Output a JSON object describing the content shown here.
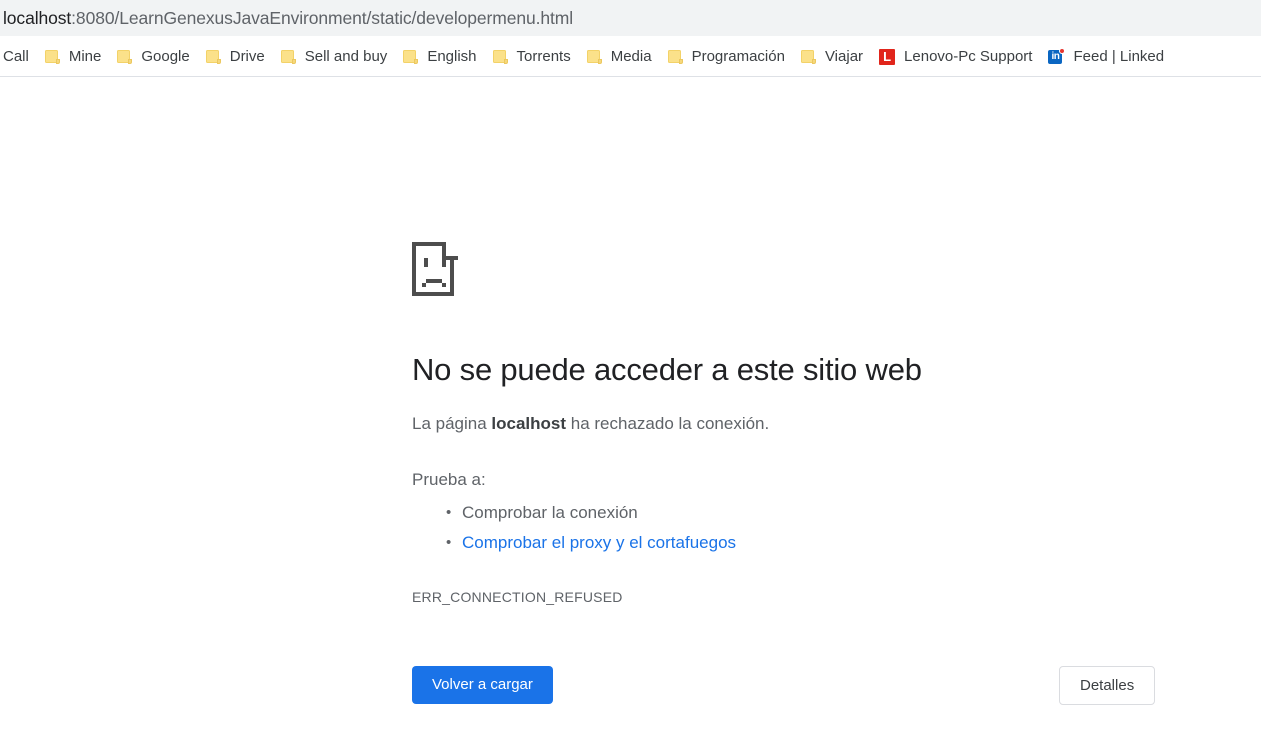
{
  "omnibox": {
    "url_host": "localhost",
    "url_rest": ":8080/LearnGenexusJavaEnvironment/static/developermenu.html"
  },
  "bookmarks": [
    {
      "label": "Call",
      "icon": "none"
    },
    {
      "label": "Mine",
      "icon": "folder-icon"
    },
    {
      "label": "Google",
      "icon": "folder-icon"
    },
    {
      "label": "Drive",
      "icon": "folder-icon"
    },
    {
      "label": "Sell and buy",
      "icon": "folder-icon"
    },
    {
      "label": "English",
      "icon": "folder-icon"
    },
    {
      "label": "Torrents",
      "icon": "folder-icon"
    },
    {
      "label": "Media",
      "icon": "folder-icon"
    },
    {
      "label": "Programación",
      "icon": "folder-icon"
    },
    {
      "label": "Viajar",
      "icon": "folder-icon"
    },
    {
      "label": "Lenovo-Pc Support",
      "icon": "lenovo-icon",
      "icon_text": "L"
    },
    {
      "label": "Feed | Linked",
      "icon": "linkedin-icon",
      "icon_text": "in"
    }
  ],
  "error_page": {
    "icon": "sad-page-icon",
    "title": "No se puede acceder a este sitio web",
    "subtitle_prefix": "La página ",
    "subtitle_host": "localhost",
    "subtitle_suffix": " ha rechazado la conexión.",
    "suggestions_label": "Prueba a:",
    "suggestions": [
      {
        "text": "Comprobar la conexión",
        "link": false
      },
      {
        "text": "Comprobar el proxy y el cortafuegos",
        "link": true
      }
    ],
    "error_code": "ERR_CONNECTION_REFUSED",
    "reload_button": "Volver a cargar",
    "details_button": "Detalles"
  },
  "colors": {
    "accent_blue": "#1a73e8",
    "link_blue": "#1a73e8",
    "text_primary": "#202124",
    "text_secondary": "#5f6368",
    "omnibox_bg": "#f1f3f4",
    "folder_yellow": "#fbe18a",
    "lenovo_red": "#e1251b",
    "linkedin_blue": "#0a66c2",
    "badge_red": "#e7362f",
    "border_gray": "#dadce0"
  }
}
